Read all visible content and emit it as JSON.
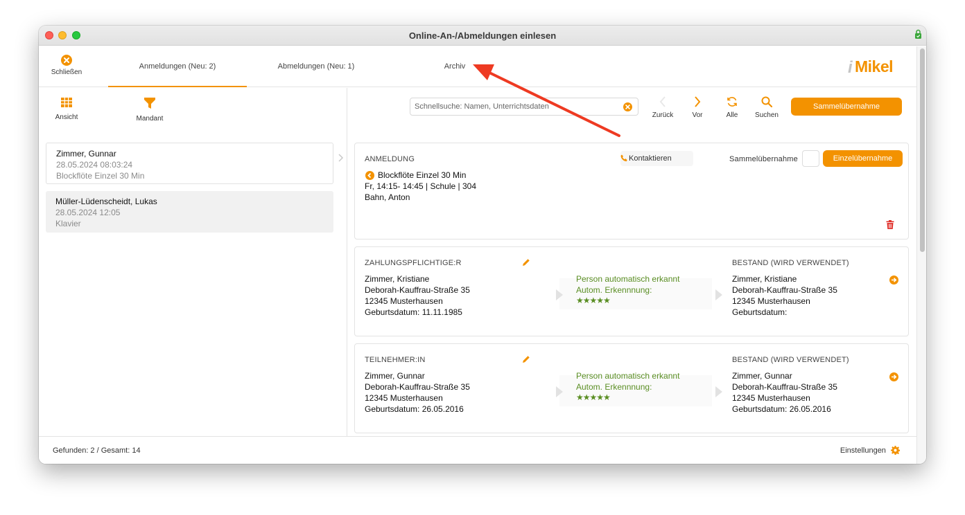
{
  "window": {
    "title": "Online-An-/Abmeldungen einlesen"
  },
  "topbar": {
    "close_label": "Schließen",
    "tabs": [
      {
        "label": "Anmeldungen (Neu: 2)",
        "active": true
      },
      {
        "label": "Abmeldungen (Neu: 1)",
        "active": false
      },
      {
        "label": "Archiv",
        "active": false
      }
    ],
    "logo_i": "i",
    "logo_text": "Mikel"
  },
  "left": {
    "tools": {
      "view_label": "Ansicht",
      "mandant_label": "Mandant"
    },
    "items": [
      {
        "name": "Zimmer, Gunnar",
        "date": "28.05.2024 08:03:24",
        "course": "Blockflöte Einzel 30 Min"
      },
      {
        "name": "Müller-Lüdenscheidt, Lukas",
        "date": "28.05.2024 12:05",
        "course": "Klavier"
      }
    ]
  },
  "right": {
    "search": {
      "placeholder": "Schnellsuche: Namen, Unterrichtsdaten"
    },
    "nav": {
      "back": "Zurück",
      "forward": "Vor",
      "all": "Alle",
      "search": "Suchen"
    },
    "bulk_button": "Sammelübernahme",
    "anmeldung": {
      "header": "ANMELDUNG",
      "contact": "Kontaktieren",
      "bulk_label": "Sammelübernahme",
      "single_button": "Einzelübernahme",
      "course": "Blockflöte Einzel 30 Min",
      "time": "Fr, 14:15- 14:45 | Schule | 304",
      "teacher": "Bahn, Anton"
    },
    "payer": {
      "header": "ZAHLUNGSPFLICHTIGE:R",
      "name": "Zimmer, Kristiane",
      "street": "Deborah-Kauffrau-Straße 35",
      "city": "12345 Musterhausen",
      "birth": "Geburtsdatum: 11.11.1985",
      "match_text": "Person automatisch erkannt",
      "match_label": "Autom. Erkennnung:",
      "stars": "★★★★★",
      "existing_header": "BESTAND (WIRD VERWENDET)",
      "existing_name": "Zimmer, Kristiane",
      "existing_street": "Deborah-Kauffrau-Straße 35",
      "existing_city": "12345 Musterhausen",
      "existing_birth": "Geburtsdatum:"
    },
    "participant": {
      "header": "TEILNEHMER:IN",
      "name": "Zimmer, Gunnar",
      "street": "Deborah-Kauffrau-Straße 35",
      "city": "12345 Musterhausen",
      "birth": "Geburtsdatum: 26.05.2016",
      "match_text": "Person automatisch erkannt",
      "match_label": "Autom. Erkennnung:",
      "stars": "★★★★★",
      "existing_header": "BESTAND (WIRD VERWENDET)",
      "existing_name": "Zimmer, Gunnar",
      "existing_street": "Deborah-Kauffrau-Straße 35",
      "existing_city": "12345 Musterhausen",
      "existing_birth": "Geburtsdatum: 26.05.2016"
    }
  },
  "status": {
    "found": "Gefunden: 2 / Gesamt: 14",
    "settings": "Einstellungen"
  },
  "colors": {
    "accent": "#f39200",
    "green": "#5a8e23",
    "delete": "#e0302a",
    "annotation": "#ee3a22"
  }
}
